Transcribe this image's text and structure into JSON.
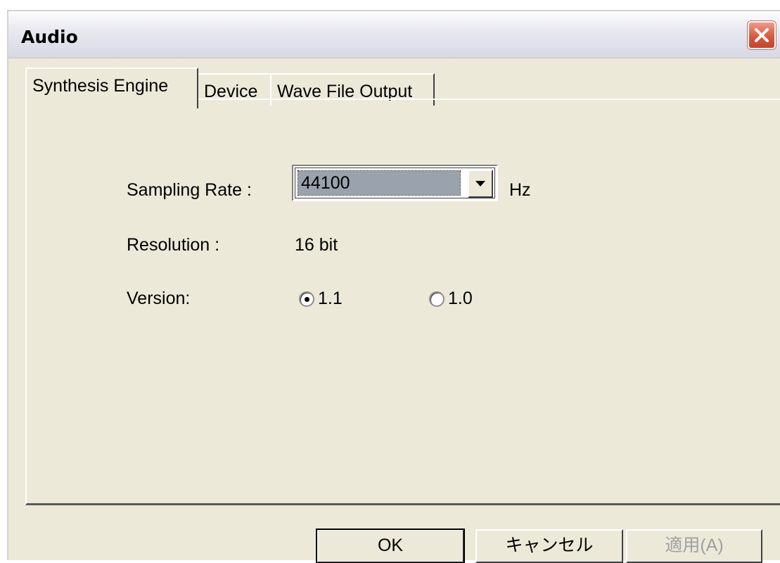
{
  "window": {
    "title": "Audio"
  },
  "tabs": [
    {
      "label": "Synthesis Engine",
      "active": true
    },
    {
      "label": "Device",
      "active": false
    },
    {
      "label": "Wave File Output",
      "active": false
    }
  ],
  "synthesis": {
    "sampling_rate_label": "Sampling Rate :",
    "sampling_rate_value": "44100",
    "sampling_rate_unit": "Hz",
    "resolution_label": "Resolution :",
    "resolution_value": "16  bit",
    "version_label": "Version:",
    "version_options": [
      {
        "label": "1.1",
        "checked": true
      },
      {
        "label": "1.0",
        "checked": false
      }
    ]
  },
  "buttons": {
    "ok": "OK",
    "cancel": "キャンセル",
    "apply": "適用(A)"
  },
  "icons": [
    "close-icon",
    "dropdown-arrow-icon"
  ]
}
